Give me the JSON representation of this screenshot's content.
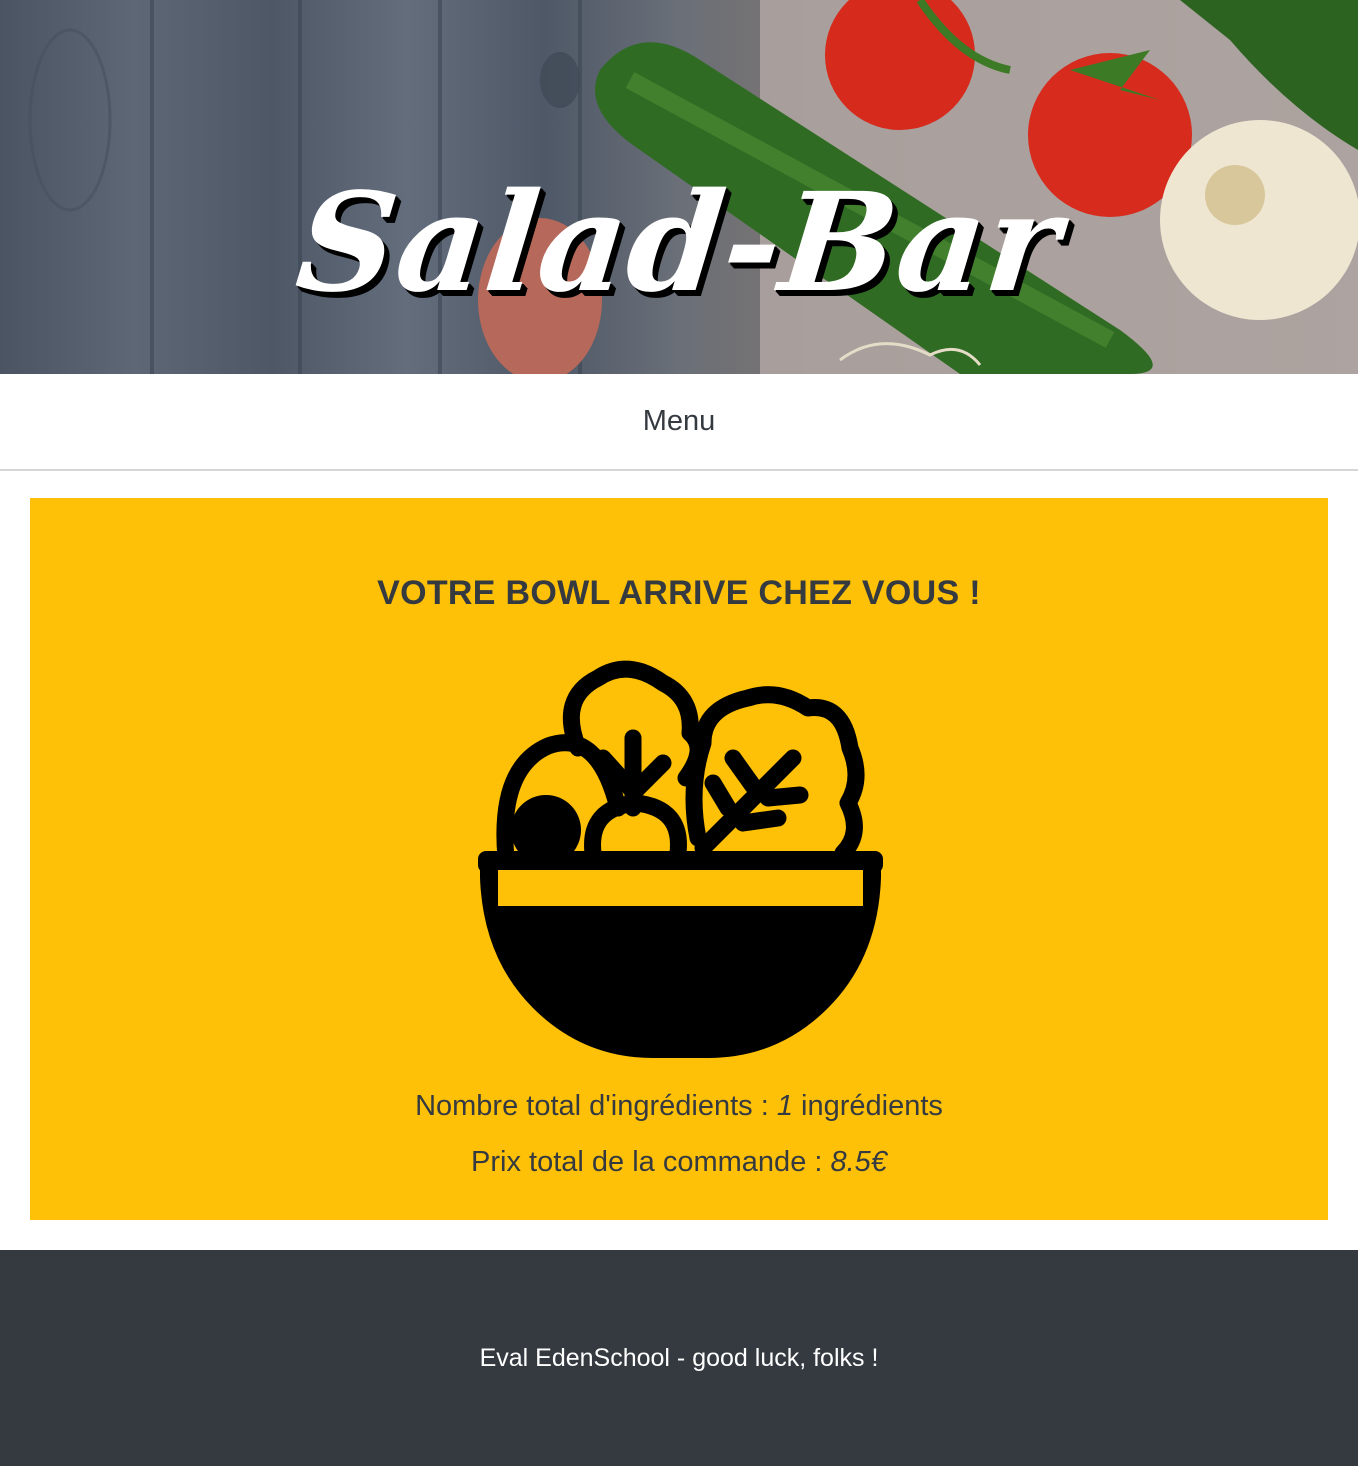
{
  "header": {
    "title": "Salad-Bar"
  },
  "nav": {
    "menu_label": "Menu"
  },
  "order": {
    "heading": "VOTRE BOWL ARRIVE CHEZ VOUS !",
    "icon": "salad-bowl-icon",
    "ingredients_prefix": "Nombre total d'ingrédients : ",
    "ingredients_count": "1",
    "ingredients_suffix": " ingrédients",
    "price_prefix": "Prix total de la commande : ",
    "price_value": "8.5€"
  },
  "footer": {
    "text": "Eval EdenSchool - good luck, folks !"
  },
  "colors": {
    "panel": "#ffc107",
    "footer": "#343a40",
    "text": "#343a40"
  }
}
